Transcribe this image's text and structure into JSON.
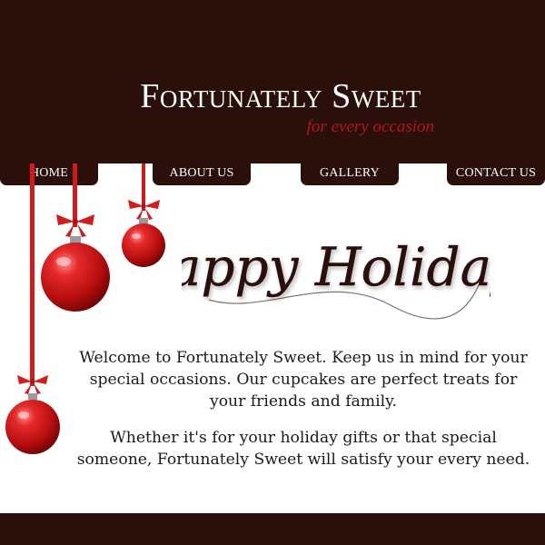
{
  "brand": {
    "name": "Fortunately Sweet",
    "tagline": "for every occasion"
  },
  "nav": {
    "home": "HOME",
    "about": "ABOUT US",
    "gallery": "GALLERY",
    "contact": "CONTACT US"
  },
  "hero": {
    "greeting": "Happy Holidays"
  },
  "content": {
    "paragraph1": "Welcome to Fortunately Sweet. Keep us in mind for your special occasions. Our cupcakes are perfect treats for your friends and family.",
    "paragraph2": "Whether it's for your holiday gifts or that special someone, Fortunately Sweet will satisfy your every need."
  },
  "colors": {
    "header_bg": "#2b0f0b",
    "accent_red": "#b4151b",
    "text": "#1a1a1a"
  },
  "decor": {
    "ornaments": [
      "ornament-ball-icon",
      "ornament-ball-icon",
      "ornament-ball-icon"
    ]
  }
}
